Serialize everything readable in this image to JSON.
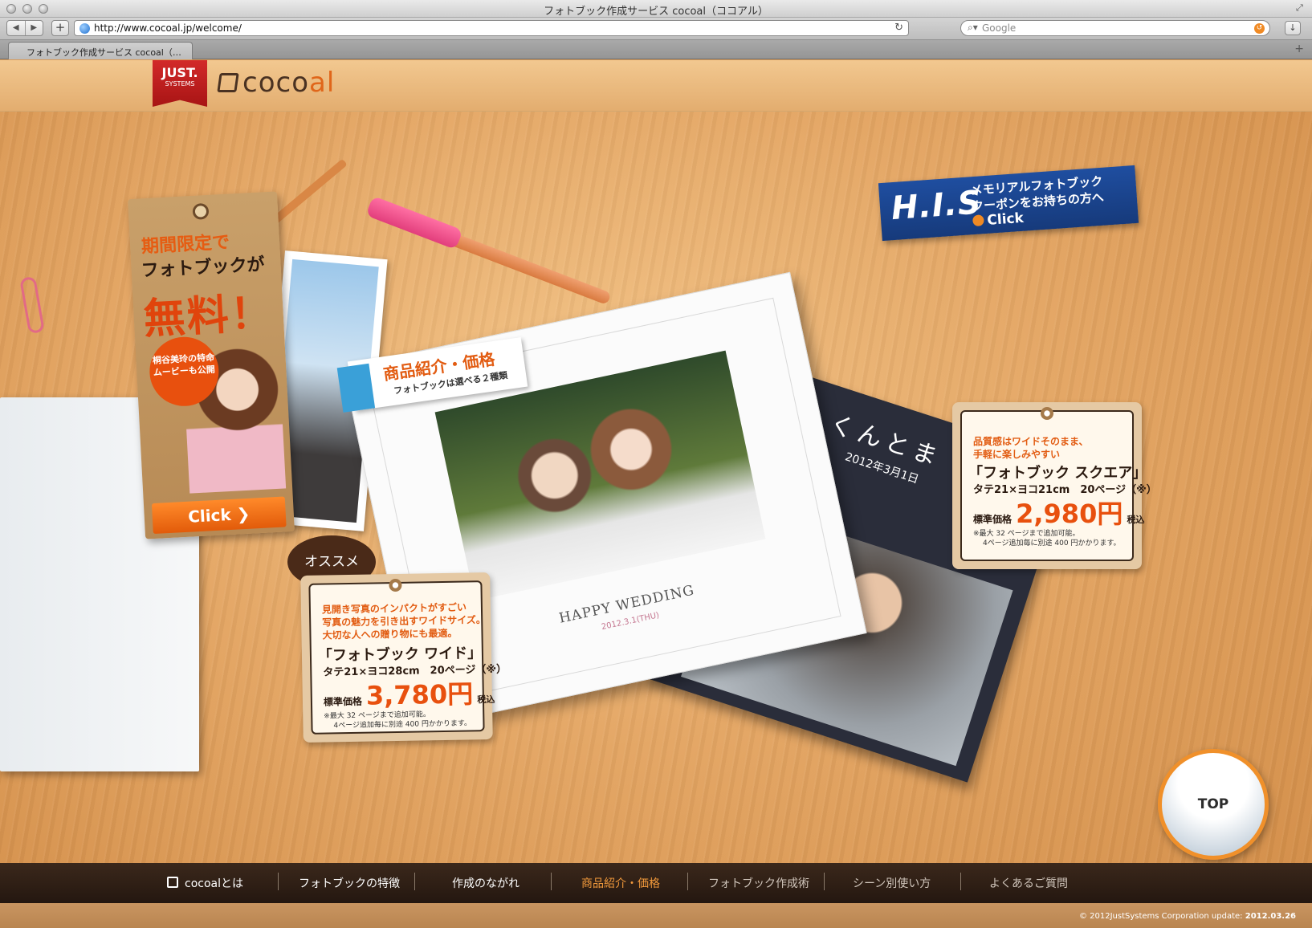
{
  "browser": {
    "window_title": "フォトブック作成サービス cocoal（ココアル）",
    "url": "http://www.cocoal.jp/welcome/",
    "search_placeholder": "Google",
    "tab_title": "フォトブック作成サービス cocoal（…"
  },
  "header": {
    "just_logo": "JUST.",
    "just_sub": "SYSTEMS",
    "cocoal_logo_main": "coco",
    "cocoal_logo_accent": "al"
  },
  "campaign": {
    "line1": "期間限定で",
    "line2": "フォトブックが",
    "line3": "無料！",
    "bubble": "桐谷美玲の特命ムービーも公開",
    "click_label": "Click ❯"
  },
  "his_banner": {
    "logo": "H.I.S",
    "line1": "メモリアルフォトブック",
    "line2": "クーポンをお持ちの方へ",
    "click_label": "Click"
  },
  "product_tag": {
    "title": "商品紹介・価格",
    "subtitle": "フォトブックは選べる２種類"
  },
  "album_white": {
    "title": "HAPPY WEDDING",
    "date": "2012.3.1(THU)"
  },
  "album_dark": {
    "title": "くんとま",
    "date": "2012年3月1日"
  },
  "recommend_badge": "オススメ",
  "price_wide": {
    "desc1": "見開き写真のインパクトがすごい",
    "desc2": "写真の魅力を引き出すワイドサイズ。",
    "desc3": "大切な人への贈り物にも最適。",
    "name": "「フォトブック ワイド」",
    "size": "タテ21×ヨコ28cm　20ページ（※）",
    "price_label": "標準価格",
    "price": "3,780円",
    "tax": "税込",
    "note1": "※最大 32 ページまで追加可能。",
    "note2": "4ページ追加毎に別途 400 円かかります。"
  },
  "price_square": {
    "desc1": "品質感はワイドそのまま、",
    "desc2": "手軽に楽しみやすい",
    "name": "「フォトブック スクエア」",
    "size": "タテ21×ヨコ21cm　20ページ（※）",
    "price_label": "標準価格",
    "price": "2,980円",
    "tax": "税込",
    "note1": "※最大 32 ページまで追加可能。",
    "note2": "4ページ追加毎に別途 400 円かかります。"
  },
  "top_button": "TOP",
  "nav": {
    "items": [
      {
        "label": "cocoalとは"
      },
      {
        "label": "フォトブックの特徴"
      },
      {
        "label": "作成のながれ"
      },
      {
        "label": "商品紹介・価格"
      },
      {
        "label": "フォトブック作成術"
      },
      {
        "label": "シーン別使い方"
      },
      {
        "label": "よくあるご質問"
      }
    ]
  },
  "footer": {
    "copyright": "© 2012JustSystems Corporation  update:",
    "update_date": "2012.03.26"
  },
  "colors": {
    "accent_orange": "#e8500e",
    "nav_active": "#f39a3c",
    "his_blue": "#1f4ea0"
  }
}
